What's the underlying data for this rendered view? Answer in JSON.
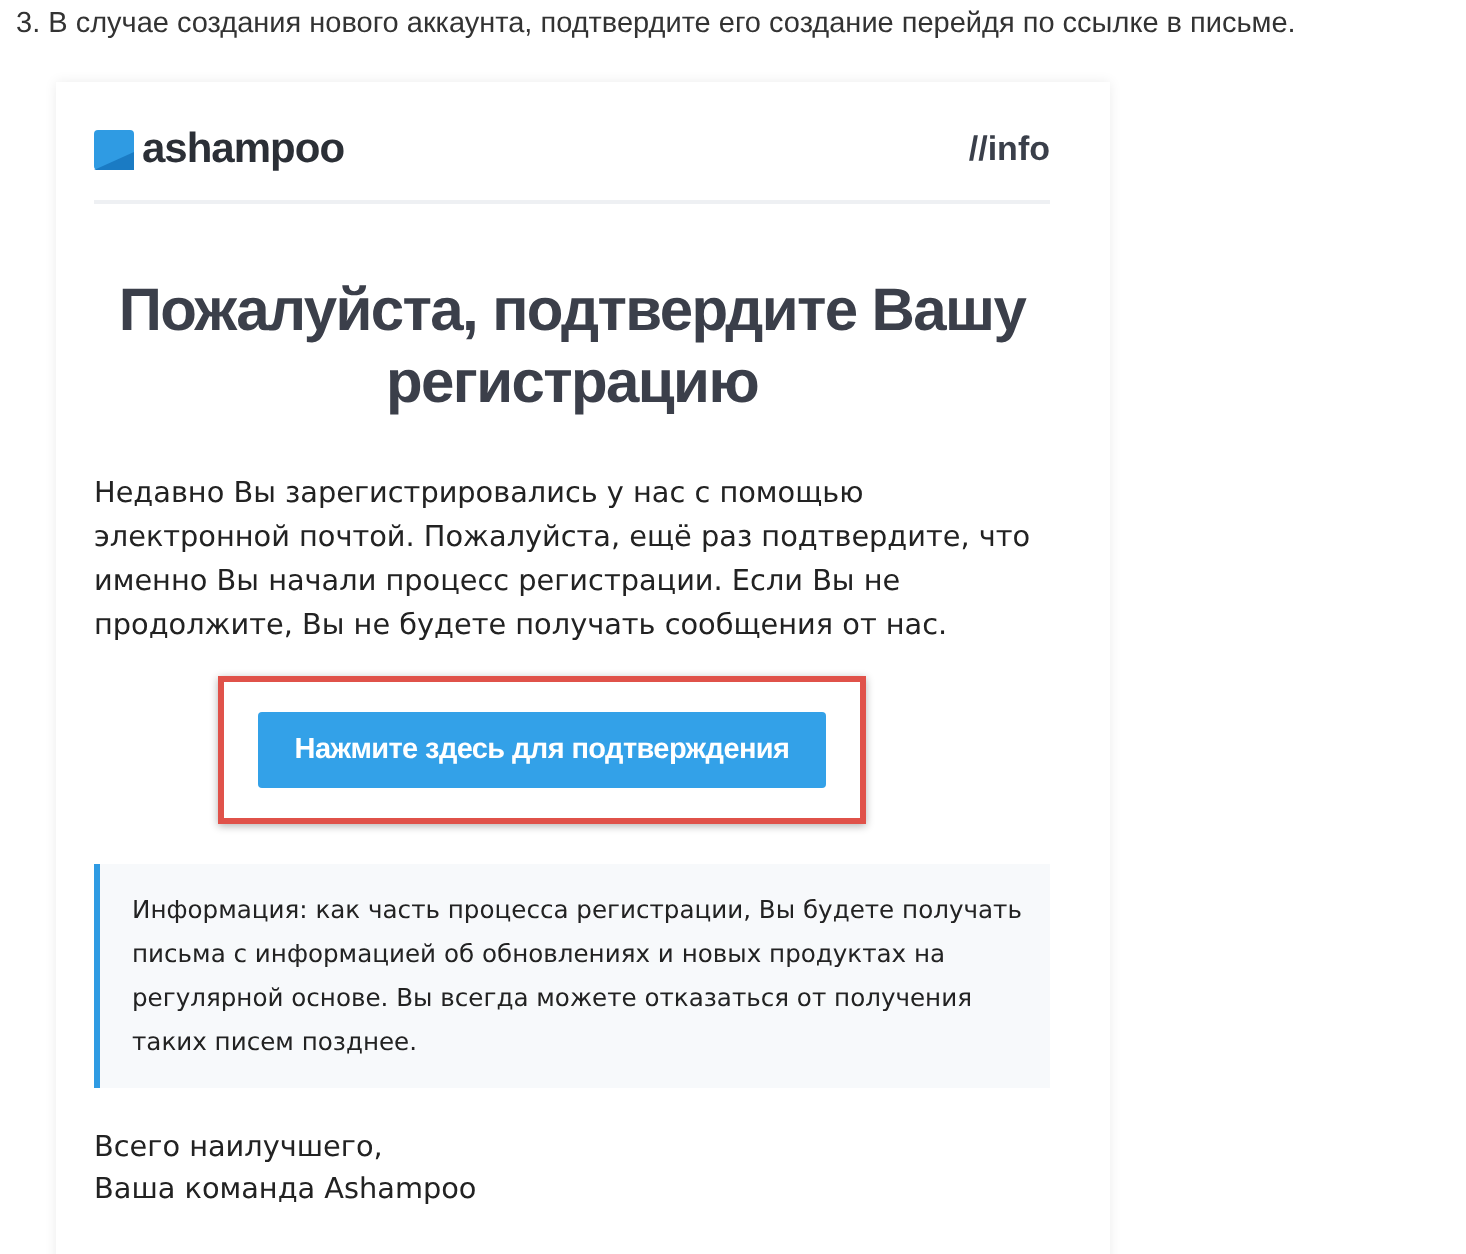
{
  "step_text": "3. В случае создания нового аккаунта, подтвердите его создание перейдя по ссылке в письме.",
  "email": {
    "logo_text": "ashampoo",
    "header_tag": "//info",
    "title": "Пожалуйста, подтвердите Вашу регистрацию",
    "body": "Недавно Вы зарегистрировались у нас с помощью электронной почтой. Пожалуйста, ещё раз подтвердите, что именно Вы начали процесс регистрации. Если Вы не продолжите, Вы не будете получать сообщения от нас.",
    "button": {
      "label": "Нажмите здесь для подтверждения",
      "highlighted": true
    },
    "info": "Информация: как часть процесса регистрации, Вы будете получать письма с информацией об обновлениях и новых продуктах на регулярной основе. Вы всегда можете отказаться от получения таких писем позднее.",
    "signature": [
      "Всего наилучшего,",
      "Ваша команда Ashampoo"
    ]
  }
}
